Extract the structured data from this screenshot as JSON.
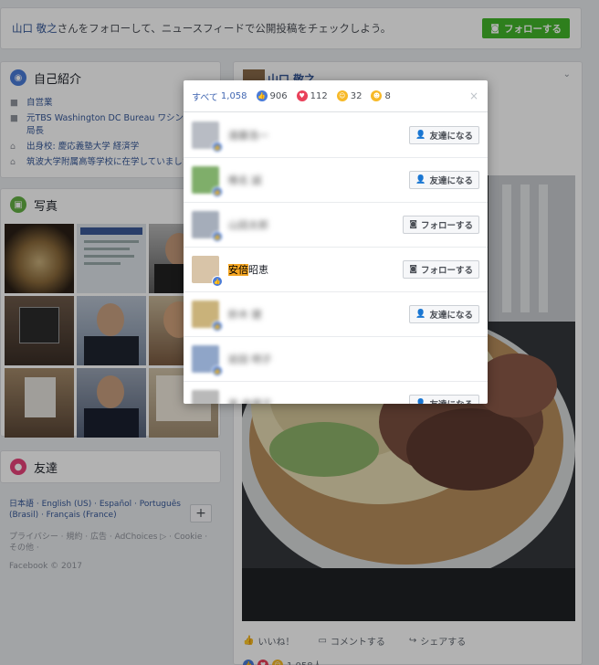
{
  "follow_bar": {
    "name": "山口 敬之",
    "text": "さんをフォローして、ニュースフィードで公開投稿をチェックしよう。",
    "button_label": "フォローする"
  },
  "intro": {
    "title": "自己紹介",
    "items": [
      {
        "icon": "briefcase-icon",
        "text": "自営業"
      },
      {
        "icon": "briefcase-icon",
        "text": "元TBS Washington DC Bureau ワシントン支局長"
      },
      {
        "icon": "graduation-cap-icon",
        "text": "出身校: 慶応義塾大学 経済学"
      },
      {
        "icon": "graduation-cap-icon",
        "text": "筑波大学附属高等学校に在学していました"
      }
    ]
  },
  "photos": {
    "title": "写真"
  },
  "friends": {
    "title": "友達"
  },
  "footer": {
    "langs": "日本語 · English (US) · Español · Português (Brasil) · Français (France)",
    "links": "プライバシー · 規約 · 広告 · AdChoices ▷ · Cookie · その他 ·",
    "copyright": "Facebook © 2017",
    "plus": "+"
  },
  "post": {
    "author": "山口 敬之",
    "actions": {
      "like": "いいね！",
      "comment": "コメントする",
      "share": "シェアする"
    },
    "reaction_count": "1,058人"
  },
  "modal": {
    "tab_all_label": "すべて",
    "tab_all_count": "1,058",
    "tabs": [
      {
        "icon": "like-icon",
        "count": "906",
        "color": "#4a7bd8"
      },
      {
        "icon": "love-icon",
        "count": "112",
        "color": "#e9415a"
      },
      {
        "icon": "wow-icon",
        "count": "32",
        "color": "#f7b928"
      },
      {
        "icon": "haha-icon",
        "count": "8",
        "color": "#f7b928"
      }
    ],
    "close": "×",
    "rows": [
      {
        "name": "遠藤浩一",
        "button": "友達になる",
        "btype": "friend",
        "blur": true
      },
      {
        "name": "椎名 誠",
        "button": "友達になる",
        "btype": "friend",
        "blur": true
      },
      {
        "name": "山田太郎",
        "button": "フォローする",
        "btype": "follow",
        "blur": true
      },
      {
        "name": "安倍昭恵",
        "highlight": "安倍",
        "rest": "昭恵",
        "button": "フォローする",
        "btype": "follow",
        "blur": false
      },
      {
        "name": "鈴木 健",
        "button": "友達になる",
        "btype": "friend",
        "blur": true
      },
      {
        "name": "岩田 明子",
        "button": "",
        "btype": "none",
        "blur": true
      },
      {
        "name": "高 倉健子",
        "button": "友達になる",
        "btype": "friend",
        "blur": true
      }
    ]
  }
}
